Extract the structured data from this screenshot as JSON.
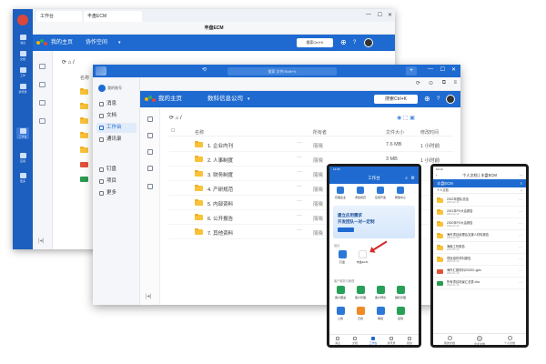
{
  "back_window": {
    "tab_label": "工作台",
    "window_title": "丰盘ECM",
    "nav_home": "我的主页",
    "nav_space": "协作空间",
    "search_label": "搜索Ctrl+K",
    "path": "/",
    "rail": [
      {
        "label": "消息"
      },
      {
        "label": "文档"
      },
      {
        "label": "工作"
      },
      {
        "label": "通讯录"
      },
      {
        "label": "工作台"
      },
      {
        "label": "应用"
      },
      {
        "label": "更多"
      }
    ],
    "col_name": "名称"
  },
  "mid_window": {
    "search_placeholder": "搜索 文件/Shift+K",
    "user_name": "我的账号",
    "sidebar": [
      {
        "label": "消息"
      },
      {
        "label": "文档"
      },
      {
        "label": "工作台"
      },
      {
        "label": "通讯录"
      },
      {
        "label": "钉盘"
      },
      {
        "label": "项目"
      },
      {
        "label": "更多"
      }
    ],
    "nav_home": "我的主页",
    "nav_company": "数科信息公司",
    "search_label": "搜索Ctrl+K",
    "path": "/",
    "headers": {
      "name": "名称",
      "owner": "所有者",
      "size": "文件大小",
      "modified": "修改时间"
    },
    "rows": [
      {
        "name": "1. 企业内刊",
        "owner": "丽晓",
        "size": "7.6 MB",
        "time": "1 小时前"
      },
      {
        "name": "2. 人事制度",
        "owner": "丽晓",
        "size": "3 MB",
        "time": "1 小时前"
      },
      {
        "name": "3. 财务制度",
        "owner": "丽晓",
        "size": "",
        "time": ""
      },
      {
        "name": "4. 产研规范",
        "owner": "丽晓",
        "size": "",
        "time": ""
      },
      {
        "name": "5. 内部资料",
        "owner": "丽晓",
        "size": "",
        "time": ""
      },
      {
        "name": "6. 公开报告",
        "owner": "丽晓",
        "size": "",
        "time": ""
      },
      {
        "name": "7. 其他资料",
        "owner": "丽晓",
        "size": "",
        "time": ""
      }
    ]
  },
  "phone1": {
    "status": "14:58",
    "header": "工作台",
    "quick": [
      {
        "label": "管理企业"
      },
      {
        "label": "添加成员"
      },
      {
        "label": "应用开发"
      },
      {
        "label": "帮助中心"
      }
    ],
    "banner_line1": "建立应用需求",
    "banner_line2": "开发团队一对一定制",
    "section_recent": "最近",
    "recent_apps": [
      {
        "label": "钉盘"
      },
      {
        "label": "丰盘ECM"
      }
    ],
    "section_company": "客户服务与管理",
    "apps": [
      {
        "label": "客户跟进"
      },
      {
        "label": "客户管理"
      },
      {
        "label": "客户拜访"
      },
      {
        "label": "销售管理"
      },
      {
        "label": "公告"
      },
      {
        "label": "日志"
      },
      {
        "label": "审批"
      },
      {
        "label": "签到"
      }
    ],
    "tabs": [
      {
        "label": "消息"
      },
      {
        "label": "文档"
      },
      {
        "label": "工作台"
      },
      {
        "label": "通讯录"
      },
      {
        "label": "我的"
      }
    ]
  },
  "phone2": {
    "status": "12:10",
    "title": "个人文档 | 丰盘ECM",
    "bar_title": "丰盘ECM",
    "sub": "个人文档",
    "files": [
      {
        "name": "2022年团队总结",
        "meta": "2022-01-19",
        "type": "folder"
      },
      {
        "name": "2021年PG大会报告",
        "meta": "2022-01-19",
        "type": "folder"
      },
      {
        "name": "2020年PG大会报告",
        "meta": "2022-01-19",
        "type": "folder"
      },
      {
        "name": "海外项目经理会支援人材料报告",
        "meta": "2022-01-19",
        "type": "folder"
      },
      {
        "name": "海南工作报告",
        "meta": "2022-01-19",
        "type": "folder"
      },
      {
        "name": "项目组件材料报告",
        "meta": "2022-01-19",
        "type": "folder"
      },
      {
        "name": "海外汇报材料202301.pptx",
        "meta": "2022-01-19",
        "type": "ppt"
      },
      {
        "name": "所有项目场景汇总表.xlsx",
        "meta": "2022-01-19",
        "type": "xls"
      }
    ],
    "tabs": [
      {
        "label": "我的文档"
      },
      {
        "label": "企业文档"
      },
      {
        "label": "个人文档"
      }
    ]
  }
}
